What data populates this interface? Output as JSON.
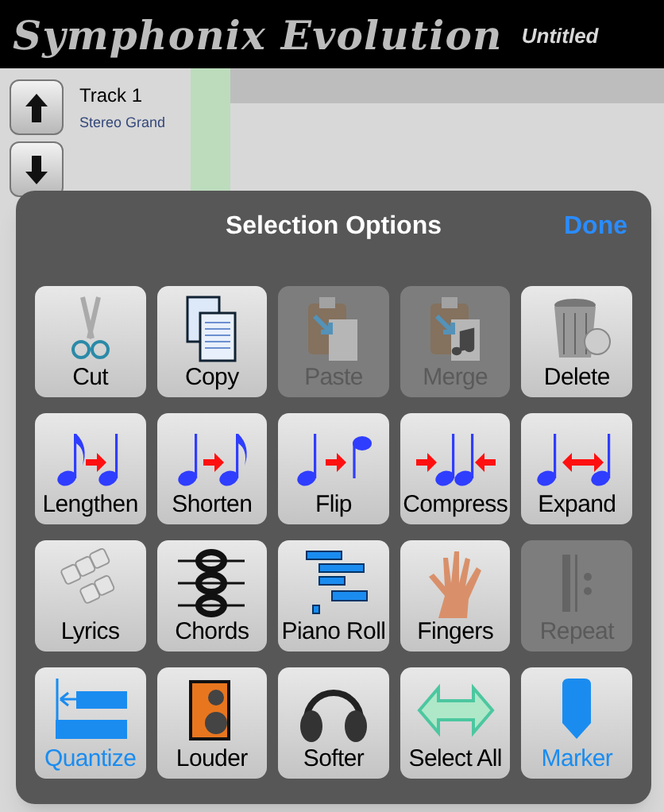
{
  "app": {
    "logo": "Symphonix Evolution",
    "document": "Untitled"
  },
  "track": {
    "name": "Track 1",
    "instrument": "Stereo Grand"
  },
  "panel": {
    "title": "Selection Options",
    "done": "Done"
  },
  "buttons": [
    {
      "label": "Cut",
      "kind": "scissors",
      "disabled": false,
      "active": false
    },
    {
      "label": "Copy",
      "kind": "pages",
      "disabled": false,
      "active": false
    },
    {
      "label": "Paste",
      "kind": "clipboard",
      "disabled": true,
      "active": false
    },
    {
      "label": "Merge",
      "kind": "clipboard-note",
      "disabled": true,
      "active": false
    },
    {
      "label": "Delete",
      "kind": "trash",
      "disabled": false,
      "active": false
    },
    {
      "label": "Lengthen",
      "kind": "lengthen",
      "disabled": false,
      "active": false
    },
    {
      "label": "Shorten",
      "kind": "shorten",
      "disabled": false,
      "active": false
    },
    {
      "label": "Flip",
      "kind": "flip",
      "disabled": false,
      "active": false
    },
    {
      "label": "Compress",
      "kind": "compress",
      "disabled": false,
      "active": false
    },
    {
      "label": "Expand",
      "kind": "expand",
      "disabled": false,
      "active": false
    },
    {
      "label": "Lyrics",
      "kind": "keys",
      "disabled": false,
      "active": false
    },
    {
      "label": "Chords",
      "kind": "chords",
      "disabled": false,
      "active": false
    },
    {
      "label": "Piano Roll",
      "kind": "pianoroll",
      "disabled": false,
      "active": false
    },
    {
      "label": "Fingers",
      "kind": "hand",
      "disabled": false,
      "active": false
    },
    {
      "label": "Repeat",
      "kind": "repeat",
      "disabled": true,
      "active": false
    },
    {
      "label": "Quantize",
      "kind": "quantize",
      "disabled": false,
      "active": true
    },
    {
      "label": "Louder",
      "kind": "speaker",
      "disabled": false,
      "active": false
    },
    {
      "label": "Softer",
      "kind": "headphones",
      "disabled": false,
      "active": false
    },
    {
      "label": "Select All",
      "kind": "arrows",
      "disabled": false,
      "active": false
    },
    {
      "label": "Marker",
      "kind": "marker",
      "disabled": false,
      "active": true
    }
  ]
}
